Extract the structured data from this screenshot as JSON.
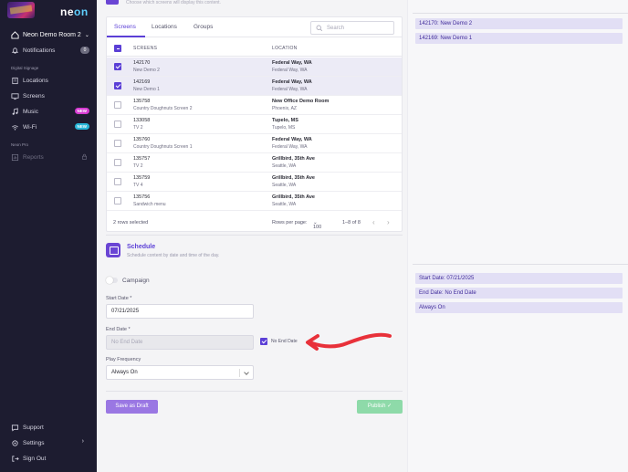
{
  "sidebar": {
    "logo_text_a": "ne",
    "logo_text_b": "on",
    "org_name": "Neon Demo Room 2",
    "notifications_label": "Notifications",
    "notifications_count": "0",
    "section_digital": "Digital Signage",
    "locations": "Locations",
    "screens": "Screens",
    "music": "Music",
    "music_badge": "NEW",
    "wifi": "Wi-Fi",
    "wifi_badge": "NEW",
    "section_pro": "Neon Pro",
    "reports": "Reports",
    "support": "Support",
    "settings": "Settings",
    "signout": "Sign Out"
  },
  "top": {
    "caption": "Choose which screens will display this content."
  },
  "tabs": [
    "Screens",
    "Locations",
    "Groups"
  ],
  "search": {
    "placeholder": "Search"
  },
  "table": {
    "headers": {
      "screens": "SCREENS",
      "location": "LOCATION"
    },
    "rows": [
      {
        "id": "142170",
        "name": "New Demo 2",
        "location": "Federal Way, WA",
        "address": "Federal Way, WA",
        "selected": true
      },
      {
        "id": "142169",
        "name": "New Demo 1",
        "location": "Federal Way, WA",
        "address": "Federal Way, WA",
        "selected": true
      },
      {
        "id": "135758",
        "name": "Country Doughnuts Screen 2",
        "location": "New Office Demo Room",
        "address": "Phoenix, AZ",
        "selected": false
      },
      {
        "id": "133058",
        "name": "TV 2",
        "location": "Tupelo, MS",
        "address": "Tupelo, MS",
        "selected": false
      },
      {
        "id": "135760",
        "name": "Country Doughnuts Screen 1",
        "location": "Federal Way, WA",
        "address": "Federal Way, WA",
        "selected": false
      },
      {
        "id": "135757",
        "name": "TV 2",
        "location": "Grillbird, 35th Ave",
        "address": "Seattle, WA",
        "selected": false
      },
      {
        "id": "135759",
        "name": "TV 4",
        "location": "Grillbird, 35th Ave",
        "address": "Seattle, WA",
        "selected": false
      },
      {
        "id": "135756",
        "name": "Sandwich menu",
        "location": "Grillbird, 35th Ave",
        "address": "Seattle, WA",
        "selected": false
      }
    ],
    "footer": {
      "selected": "2 rows selected",
      "rows_per_page_label": "Rows per page:",
      "rows_per_page": "100",
      "range": "1–8 of 8",
      "prev": "‹",
      "next": "›"
    }
  },
  "schedule": {
    "title": "Schedule",
    "subtitle": "Schedule content by date and time of the day.",
    "campaign": "Campaign",
    "start_label": "Start Date *",
    "start_value": "07/21/2025",
    "end_label": "End Date *",
    "end_placeholder": "No End Date",
    "no_end_label": "No End Date",
    "freq_label": "Play Frequency",
    "freq_value": "Always On"
  },
  "actions": {
    "draft": "Save as Draft",
    "publish": "Publish ✓"
  },
  "summary": {
    "screens": [
      "142170: New Demo 2",
      "142169: New Demo 1"
    ],
    "schedule": [
      "Start Date: 07/21/2025",
      "End Date: No End Date",
      "Always On"
    ]
  },
  "colors": {
    "accent": "#5b3fd6",
    "sidebar": "#1d1c30",
    "publish": "#8edaa9",
    "arrow": "#e8313a"
  }
}
